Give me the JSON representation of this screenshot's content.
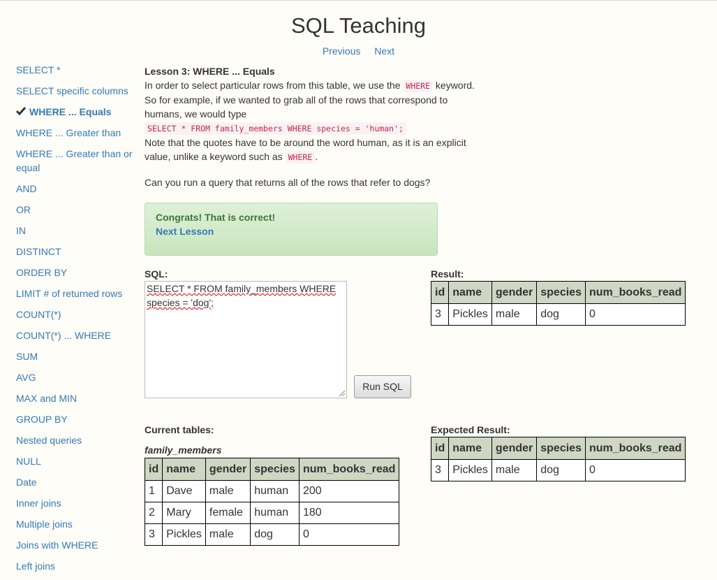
{
  "header": {
    "title": "SQL Teaching",
    "previous": "Previous",
    "next": "Next"
  },
  "sidebar": {
    "items": [
      {
        "label": "SELECT *"
      },
      {
        "label": "SELECT specific columns"
      },
      {
        "label": "WHERE ... Equals",
        "active": true,
        "icon": "check-icon"
      },
      {
        "label": "WHERE ... Greater than"
      },
      {
        "label": "WHERE ... Greater than or equal"
      },
      {
        "label": "AND"
      },
      {
        "label": "OR"
      },
      {
        "label": "IN"
      },
      {
        "label": "DISTINCT"
      },
      {
        "label": "ORDER BY"
      },
      {
        "label": "LIMIT # of returned rows"
      },
      {
        "label": "COUNT(*)"
      },
      {
        "label": "COUNT(*) ... WHERE"
      },
      {
        "label": "SUM"
      },
      {
        "label": "AVG"
      },
      {
        "label": "MAX and MIN"
      },
      {
        "label": "GROUP BY"
      },
      {
        "label": "Nested queries"
      },
      {
        "label": "NULL"
      },
      {
        "label": "Date"
      },
      {
        "label": "Inner joins"
      },
      {
        "label": "Multiple joins"
      },
      {
        "label": "Joins with WHERE"
      },
      {
        "label": "Left joins"
      }
    ]
  },
  "lesson": {
    "title": "Lesson 3: WHERE ... Equals",
    "p1_a": "In order to select particular rows from this table, we use the",
    "p1_code": "WHERE",
    "p1_b": "keyword.",
    "p2": "So for example, if we wanted to grab all of the rows that correspond to humans, we would type",
    "example_code": "SELECT * FROM family_members WHERE species = 'human';",
    "p3_a": "Note that the quotes have to be around the word human, as it is an explicit value, unlike a keyword such as",
    "p3_code": "WHERE",
    "p3_b": ".",
    "question": "Can you run a query that returns all of the rows that refer to dogs?"
  },
  "alert": {
    "message": "Congrats! That is correct!",
    "link": "Next Lesson"
  },
  "editor": {
    "label": "SQL:",
    "value_line1": "SELECT * FROM family_members WHERE",
    "value_line2": "species = 'dog';",
    "run_button": "Run SQL"
  },
  "result": {
    "label": "Result:",
    "headers": [
      "id",
      "name",
      "gender",
      "species",
      "num_books_read"
    ],
    "rows": [
      [
        "3",
        "Pickles",
        "male",
        "dog",
        "0"
      ]
    ]
  },
  "current_tables": {
    "label": "Current tables:",
    "table_name": "family_members",
    "headers": [
      "id",
      "name",
      "gender",
      "species",
      "num_books_read"
    ],
    "rows": [
      [
        "1",
        "Dave",
        "male",
        "human",
        "200"
      ],
      [
        "2",
        "Mary",
        "female",
        "human",
        "180"
      ],
      [
        "3",
        "Pickles",
        "male",
        "dog",
        "0"
      ]
    ]
  },
  "expected": {
    "label": "Expected Result:",
    "headers": [
      "id",
      "name",
      "gender",
      "species",
      "num_books_read"
    ],
    "rows": [
      [
        "3",
        "Pickles",
        "male",
        "dog",
        "0"
      ]
    ]
  }
}
